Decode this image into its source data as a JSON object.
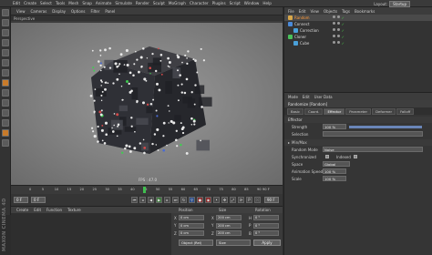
{
  "menubar": {
    "items": [
      "Edit",
      "Create",
      "Select",
      "Tools",
      "Mesh",
      "Snap",
      "Animate",
      "Simulate",
      "Render",
      "Sculpt",
      "MoGraph",
      "Character",
      "Plugins",
      "Script",
      "Window",
      "Help"
    ],
    "layout_label": "Layout:",
    "layout_value": "Startup"
  },
  "viewport": {
    "menu": [
      "View",
      "Cameras",
      "Display",
      "Options",
      "Filter",
      "Panel"
    ],
    "title": "Perspective",
    "fps": "FPS : 47.0"
  },
  "timeline": {
    "ticks": [
      "0",
      "5",
      "10",
      "15",
      "20",
      "25",
      "30",
      "35",
      "40",
      "45",
      "50",
      "55",
      "60",
      "65",
      "70",
      "75",
      "80",
      "85",
      "90"
    ],
    "end_label": "90 F",
    "progress": 0.5
  },
  "transport": {
    "current_frame": "0 F",
    "min_frame": "0 F",
    "max_frame": "90 F",
    "end_frame": "90 F"
  },
  "material": {
    "menu": [
      "Create",
      "Edit",
      "Function",
      "Texture"
    ]
  },
  "watermark": "MAXON CINEMA 4D",
  "coords": {
    "headers": [
      "Position",
      "Size",
      "Rotation"
    ],
    "rows": [
      {
        "axis": "X",
        "pos": "0 cm",
        "size_axis": "X",
        "size": "200 cm",
        "rot_axis": "H",
        "rot": "0 °"
      },
      {
        "axis": "Y",
        "pos": "0 cm",
        "size_axis": "Y",
        "size": "200 cm",
        "rot_axis": "P",
        "rot": "0 °"
      },
      {
        "axis": "Z",
        "pos": "0 cm",
        "size_axis": "Z",
        "size": "200 cm",
        "rot_axis": "B",
        "rot": "0 °"
      }
    ],
    "mode": "Object (Rel)",
    "size_mode": "Size",
    "apply": "Apply"
  },
  "objects": {
    "menu": [
      "File",
      "Edit",
      "View",
      "Objects",
      "Tags",
      "Bookmarks"
    ],
    "items": [
      {
        "name": "Random",
        "indent": 0,
        "icon_color": "#d9a84a",
        "selected": true
      },
      {
        "name": "Connect",
        "indent": 0,
        "icon_color": "#4a8ad9",
        "selected": false
      },
      {
        "name": "Correction",
        "indent": 1,
        "icon_color": "#4aa0d9",
        "selected": false
      },
      {
        "name": "Cloner",
        "indent": 0,
        "icon_color": "#49c05a",
        "selected": false
      },
      {
        "name": "Cube",
        "indent": 1,
        "icon_color": "#4aa0d9",
        "selected": false
      }
    ]
  },
  "attributes": {
    "menu": [
      "Mode",
      "Edit",
      "User Data"
    ],
    "title": "Randomize [Random]",
    "tabs": [
      "Basic",
      "Coord.",
      "Effector",
      "Parameter",
      "Deformer",
      "Falloff"
    ],
    "active_tab": "Effector",
    "section": "Effector",
    "strength_label": "Strength",
    "strength": "100 %",
    "strength_fraction": 1.0,
    "selection_label": "Selection",
    "minmax_label": "Min/Max",
    "random_mode_label": "Random Mode",
    "random_mode": "Noise",
    "sync_label": "Synchronized",
    "indexed_label": "Indexed",
    "space_label": "Space",
    "space": "Global",
    "anim_speed_label": "Animation Speed",
    "anim_speed": "100 %",
    "scale_label": "Scale",
    "scale": "100 %"
  }
}
